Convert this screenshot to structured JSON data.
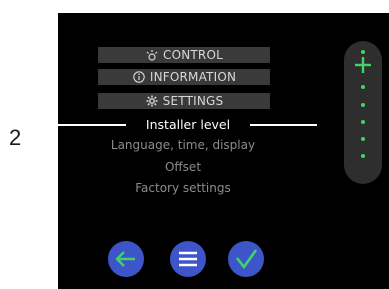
{
  "step_number": "2",
  "menu": {
    "control_label": "CONTROL",
    "information_label": "INFORMATION",
    "settings_label": "SETTINGS"
  },
  "installer_level": {
    "title": "Installer level",
    "items": [
      "Language, time, display",
      "Offset",
      "Factory settings"
    ]
  },
  "side_nav": {
    "dot_count": 5
  },
  "colors": {
    "screen_bg": "#000000",
    "menu_box_bg": "#3a3a3a",
    "accent_green": "#3fd46a",
    "button_blue": "#3d55c9",
    "sidebar_bg": "#2e2e2e"
  },
  "icons": {
    "control": "thermostat-icon",
    "information": "info-icon",
    "settings": "gear-icon",
    "plus": "plus-icon",
    "back": "arrow-left-icon",
    "menu": "hamburger-icon",
    "confirm": "checkmark-icon"
  }
}
